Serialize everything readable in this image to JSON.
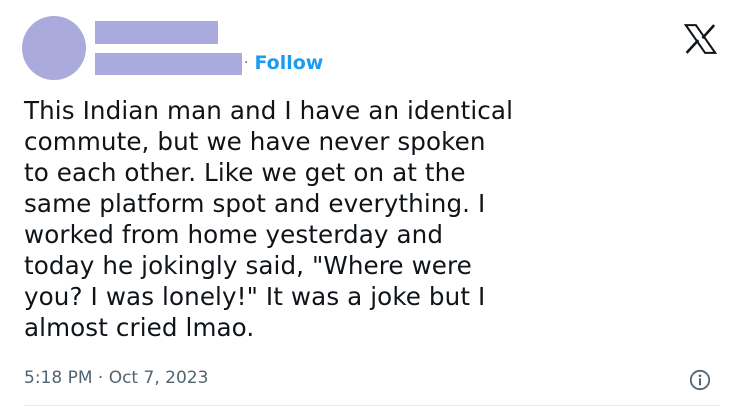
{
  "colors": {
    "placeholder": "#aaaadd",
    "follow": "#1d9bf0",
    "text": "#0f1419",
    "muted": "#536471"
  },
  "header": {
    "follow_separator": "·",
    "follow_label": "Follow",
    "logo_icon": "x-logo-icon"
  },
  "tweet": {
    "lines": [
      "This Indian man and I have an identical",
      "commute, but we have never spoken",
      "to each other. Like we get on at the",
      "same platform spot and everything. I",
      "worked from home yesterday and",
      "today he jokingly said, \"Where were",
      "you? I was lonely!\" It was a joke but I",
      "almost cried lmao."
    ],
    "timestamp": "5:18 PM · Oct 7, 2023",
    "info_icon": "info-icon"
  }
}
